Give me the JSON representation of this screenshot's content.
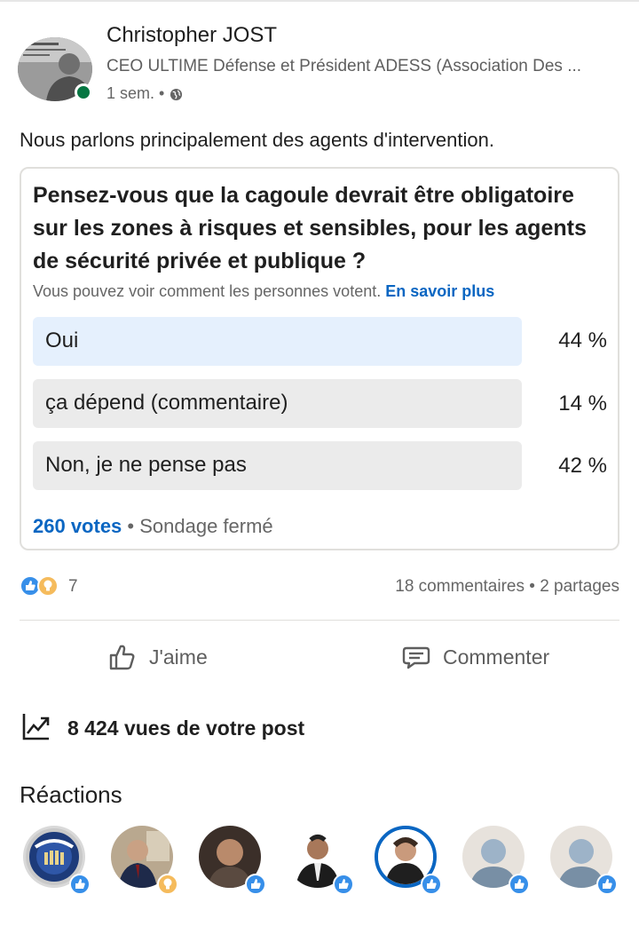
{
  "author": {
    "name": "Christopher JOST",
    "title": "CEO ULTIME Défense et Président ADESS (Association Des ...",
    "time": "1 sem. •",
    "avatar_icon": "profile-photo",
    "presence_color": "#057642"
  },
  "post": {
    "text": "Nous parlons principalement des agents d'intervention."
  },
  "poll": {
    "question": "Pensez-vous que la cagoule devrait être obligatoire sur les zones à risques et sensibles, pour les agents de sécurité privée et publique ?",
    "note": "Vous pouvez voir comment les personnes votent.",
    "learn_more": "En savoir plus",
    "options": [
      {
        "label": "Oui",
        "percent": "44 %",
        "selected": true
      },
      {
        "label": "ça dépend (commentaire)",
        "percent": "14 %",
        "selected": false
      },
      {
        "label": "Non, je ne pense pas",
        "percent": "42 %",
        "selected": false
      }
    ],
    "votes": "260 votes",
    "status": "• Sondage fermé"
  },
  "social": {
    "reaction_icons": [
      "like-icon",
      "insightful-icon"
    ],
    "reaction_count": "7",
    "comments_shares": "18 commentaires • 2 partages"
  },
  "actions": {
    "like_label": "J'aime",
    "comment_label": "Commenter"
  },
  "views": {
    "text": "8 424 vues de votre post"
  },
  "reactions": {
    "title": "Réactions",
    "people": [
      {
        "avatar": "securite-privee-logo",
        "reaction": "like"
      },
      {
        "avatar": "profile-photo",
        "reaction": "insightful"
      },
      {
        "avatar": "profile-photo",
        "reaction": "like"
      },
      {
        "avatar": "profile-photo",
        "reaction": "like"
      },
      {
        "avatar": "profile-photo",
        "reaction": "like"
      },
      {
        "avatar": "default-avatar",
        "reaction": "like"
      },
      {
        "avatar": "default-avatar",
        "reaction": "like"
      }
    ]
  },
  "colors": {
    "accent": "#0a66c2",
    "like": "#378fe9",
    "insightful": "#f5bb5c",
    "selected_option": "#e5f0fd"
  }
}
